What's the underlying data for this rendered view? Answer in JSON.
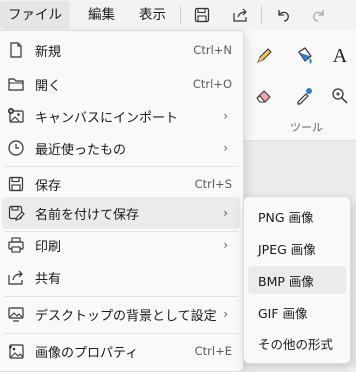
{
  "menubar": {
    "tabs": [
      "ファイル",
      "編集",
      "表示"
    ],
    "icons": [
      "save-icon",
      "share-icon",
      "undo-icon",
      "redo-icon"
    ]
  },
  "ribbon": {
    "tools_label": "ツール",
    "tool_icons": [
      "pencil-icon",
      "fill-bucket-icon",
      "text-icon",
      "eraser-icon",
      "color-picker-icon",
      "magnifier-icon"
    ]
  },
  "file_menu": {
    "items": [
      {
        "label": "新規",
        "shortcut": "Ctrl+N",
        "icon": "new-file-icon"
      },
      {
        "label": "開く",
        "shortcut": "Ctrl+O",
        "icon": "open-folder-icon"
      },
      {
        "label": "キャンバスにインポート",
        "submenu": true,
        "icon": "import-image-icon"
      },
      {
        "label": "最近使ったもの",
        "submenu": true,
        "icon": "recent-clock-icon"
      },
      {
        "label": "保存",
        "shortcut": "Ctrl+S",
        "icon": "save-icon"
      },
      {
        "label": "名前を付けて保存",
        "submenu": true,
        "icon": "save-as-icon"
      },
      {
        "label": "印刷",
        "submenu": true,
        "icon": "print-icon"
      },
      {
        "label": "共有",
        "icon": "share-icon"
      },
      {
        "label": "デスクトップの背景として設定",
        "submenu": true,
        "icon": "desktop-background-icon"
      },
      {
        "label": "画像のプロパティ",
        "shortcut": "Ctrl+E",
        "icon": "image-properties-icon"
      }
    ]
  },
  "save_as_submenu": {
    "items": [
      "PNG 画像",
      "JPEG 画像",
      "BMP 画像",
      "GIF 画像",
      "その他の形式"
    ]
  }
}
